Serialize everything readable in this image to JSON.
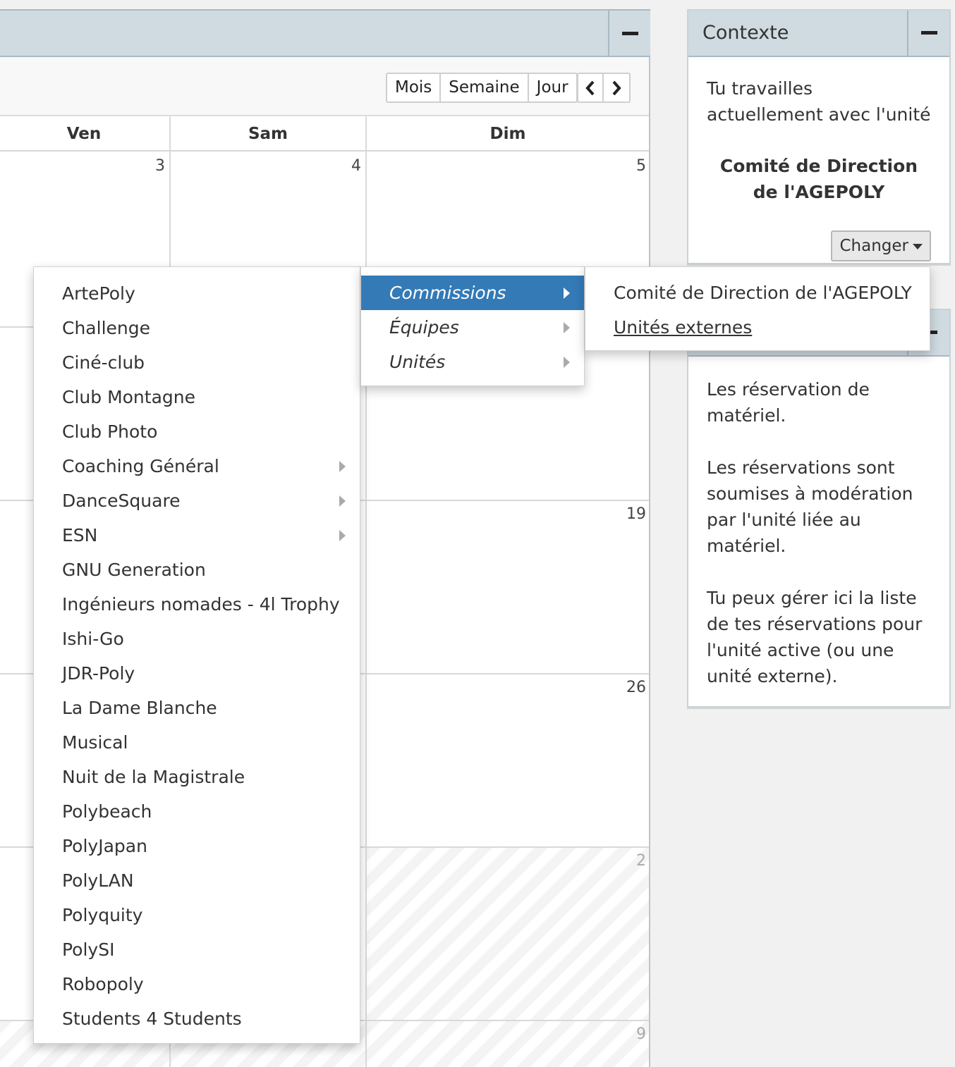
{
  "calendar": {
    "view_buttons": [
      "Mois",
      "Semaine",
      "Jour"
    ],
    "prev_label": "‹",
    "next_label": "›",
    "weekdays": [
      "Ven",
      "Sam",
      "Dim"
    ],
    "day_numbers": {
      "r1_ven": "3",
      "r1_sam": "4",
      "r1_dim": "5",
      "r3_dim": "19",
      "r4_dim": "26",
      "r5_dim": "2",
      "r6_dim": "9"
    }
  },
  "context": {
    "title": "Contexte",
    "intro": "Tu travailles actuellement avec l'unité",
    "unit": "Comité de Direction de l'AGEPOLY",
    "change_label": "Changer"
  },
  "info": {
    "p1": "Les réservation de matériel.",
    "p2": "Les réservations sont soumises à modération par l'unité liée au matériel.",
    "p3": "Tu peux gérer ici la liste de tes réservations pour l'unité active (ou une unité externe)."
  },
  "menus": {
    "units": [
      {
        "label": "ArtePoly",
        "sub": false
      },
      {
        "label": "Challenge",
        "sub": false
      },
      {
        "label": "Ciné-club",
        "sub": false
      },
      {
        "label": "Club Montagne",
        "sub": false
      },
      {
        "label": "Club Photo",
        "sub": false
      },
      {
        "label": "Coaching Général",
        "sub": true
      },
      {
        "label": "DanceSquare",
        "sub": true
      },
      {
        "label": "ESN",
        "sub": true
      },
      {
        "label": "GNU Generation",
        "sub": false
      },
      {
        "label": "Ingénieurs nomades - 4l Trophy",
        "sub": false
      },
      {
        "label": "Ishi-Go",
        "sub": false
      },
      {
        "label": "JDR-Poly",
        "sub": false
      },
      {
        "label": "La Dame Blanche",
        "sub": false
      },
      {
        "label": "Musical",
        "sub": false
      },
      {
        "label": "Nuit de la Magistrale",
        "sub": false
      },
      {
        "label": "Polybeach",
        "sub": false
      },
      {
        "label": "PolyJapan",
        "sub": false
      },
      {
        "label": "PolyLAN",
        "sub": false
      },
      {
        "label": "Polyquity",
        "sub": false
      },
      {
        "label": "PolySI",
        "sub": false
      },
      {
        "label": "Robopoly",
        "sub": false
      },
      {
        "label": "Students 4 Students",
        "sub": false
      }
    ],
    "categories": [
      {
        "label": "Commissions",
        "active": true
      },
      {
        "label": "Équipes",
        "active": false
      },
      {
        "label": "Unités",
        "active": false
      }
    ],
    "commission_items": [
      {
        "label": "Comité de Direction de l'AGEPOLY",
        "underlined": false
      },
      {
        "label": "Unités externes",
        "underlined": true
      }
    ]
  },
  "colors": {
    "header_bg": "#cfdbe1",
    "active_menu": "#337ab7"
  }
}
